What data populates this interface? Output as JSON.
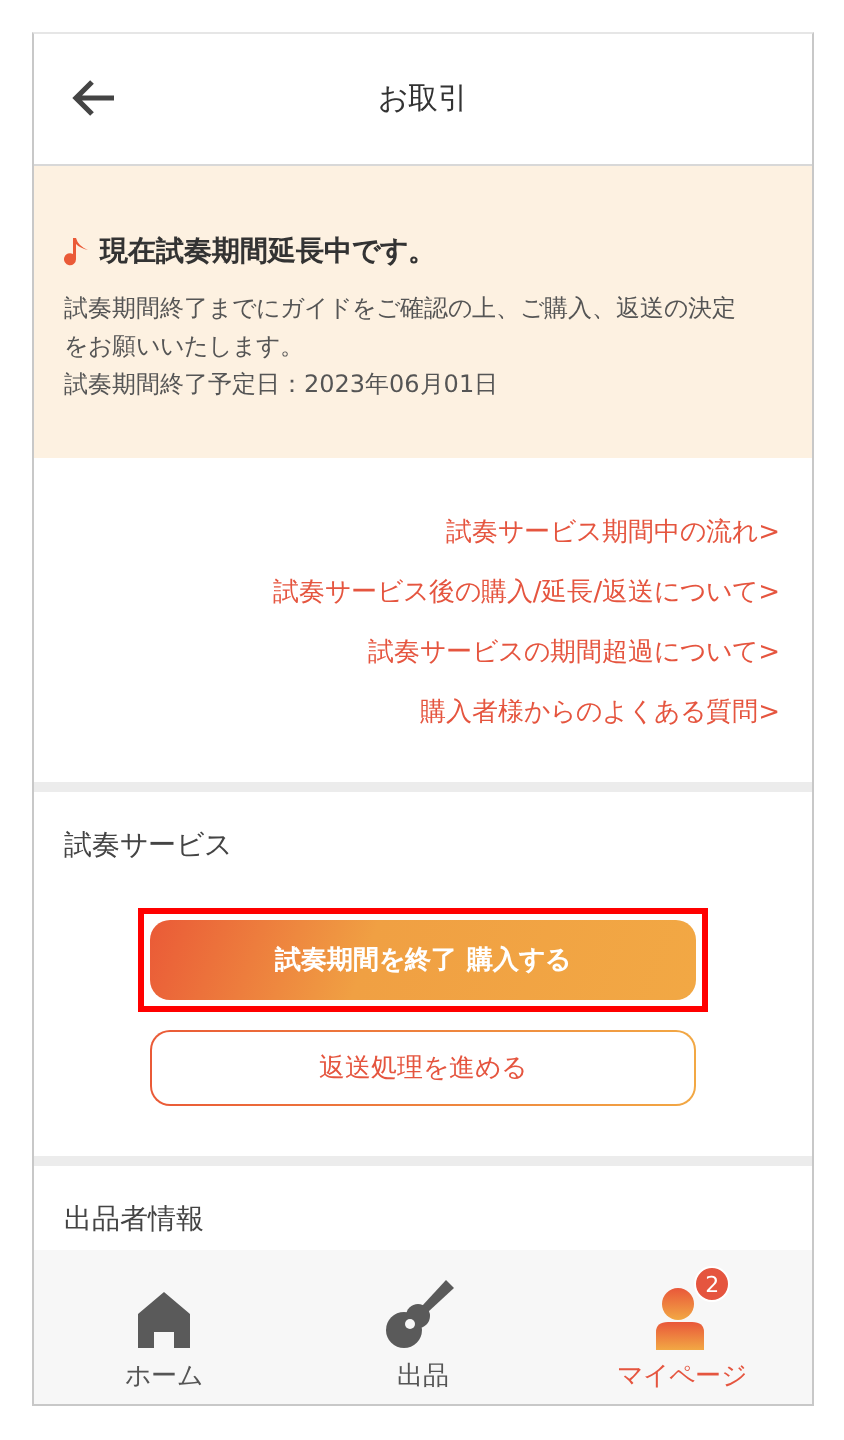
{
  "header": {
    "title": "お取引"
  },
  "notice": {
    "title": "現在試奏期間延長中です。",
    "body": "試奏期間終了までにガイドをご確認の上、ご購入、返送の決定をお願いいたします。",
    "due": "試奏期間終了予定日：2023年06月01日"
  },
  "links": [
    "試奏サービス期間中の流れ>",
    "試奏サービス後の購入/延長/返送について>",
    "試奏サービスの期間超過について>",
    "購入者様からのよくある質問>"
  ],
  "service": {
    "title": "試奏サービス",
    "buttons": [
      {
        "label": "試奏期間を終了 購入する",
        "kind": "primary",
        "highlighted": true
      },
      {
        "label": "返送処理を進める",
        "kind": "secondary",
        "highlighted": false
      }
    ]
  },
  "seller": {
    "title": "出品者情報"
  },
  "tabbar": [
    {
      "label": "ホーム",
      "kind": "home",
      "selected": false
    },
    {
      "label": "出品",
      "kind": "guitar",
      "selected": false
    },
    {
      "label": "マイページ",
      "kind": "mypage",
      "selected": true,
      "badge": "2"
    }
  ]
}
